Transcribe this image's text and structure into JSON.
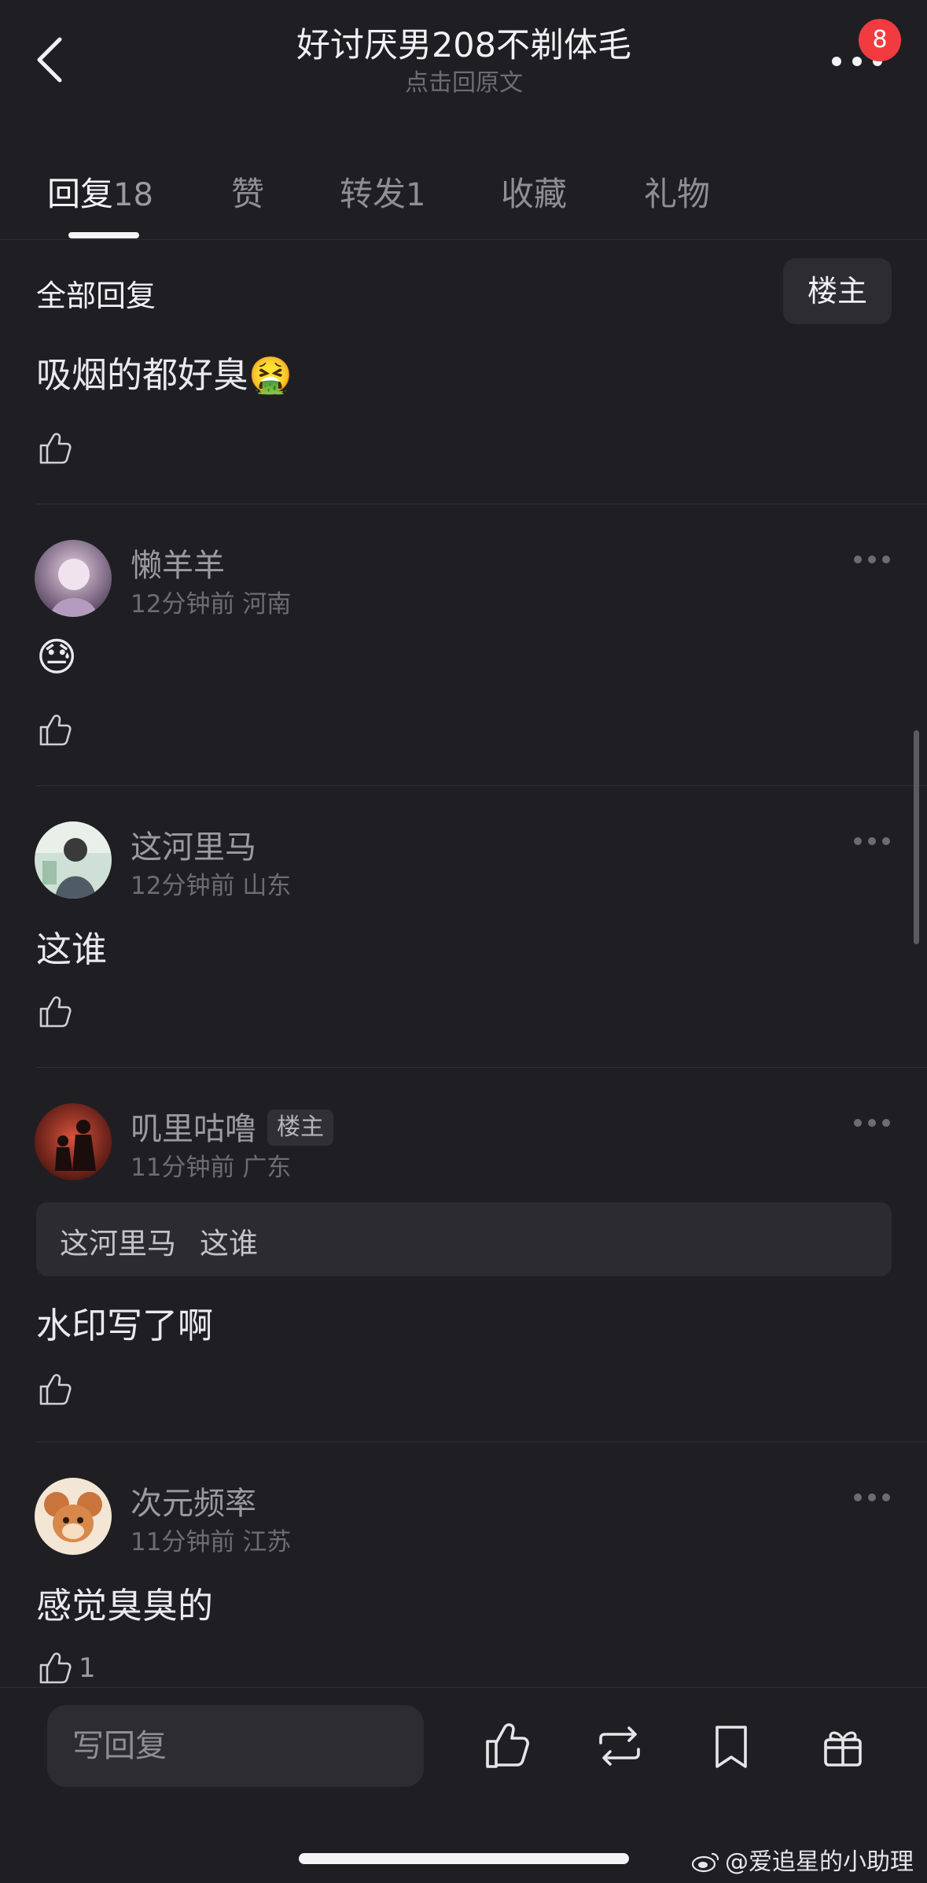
{
  "header": {
    "title": "好讨厌男208不剃体毛",
    "subtitle": "点击回原文",
    "badge_count": "8",
    "icons": {
      "back": "chevron-left-icon",
      "more": "more-horizontal-icon"
    }
  },
  "tabs": [
    {
      "label": "回复",
      "count": "18",
      "active": true
    },
    {
      "label": "赞",
      "count": "",
      "active": false
    },
    {
      "label": "转发",
      "count": "1",
      "active": false
    },
    {
      "label": "收藏",
      "count": "",
      "active": false
    },
    {
      "label": "礼物",
      "count": "",
      "active": false
    }
  ],
  "section": {
    "title": "全部回复",
    "filter_label": "楼主"
  },
  "comments": [
    {
      "text": "吸烟的都好臭",
      "emoji": "🤮",
      "likes": ""
    },
    {
      "user": "懒羊羊",
      "time": "12分钟前",
      "location": "河南",
      "text": "",
      "emoji": "😓",
      "likes": ""
    },
    {
      "user": "这河里马",
      "time": "12分钟前",
      "location": "山东",
      "text": "这谁",
      "likes": ""
    },
    {
      "user": "叽里咕噜",
      "op_tag": "楼主",
      "time": "11分钟前",
      "location": "广东",
      "quote": {
        "user": "这河里马",
        "text": "这谁"
      },
      "text": "水印写了啊",
      "likes": ""
    },
    {
      "user": "次元频率",
      "time": "11分钟前",
      "location": "江苏",
      "text": "感觉臭臭的",
      "likes": "1"
    }
  ],
  "bottom_bar": {
    "reply_placeholder": "写回复",
    "icons": [
      "like-icon",
      "repost-icon",
      "bookmark-icon",
      "gift-icon"
    ]
  },
  "watermark": "@爱追星的小助理",
  "colors": {
    "background": "#1f1f23",
    "badge": "#f23b40",
    "text_primary": "#f2f2f4",
    "text_secondary": "#9a9aa0"
  }
}
